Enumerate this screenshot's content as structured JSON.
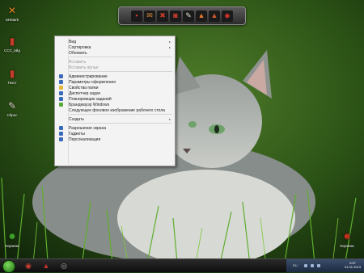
{
  "desktop": {
    "icons": [
      {
        "name": "desktop-icon-orange-x",
        "label": "SHMark",
        "glyph": "✕",
        "color": "#e8862a"
      },
      {
        "name": "desktop-icon-doc-1",
        "label": "ССС_вйд",
        "glyph": "▮",
        "color": "#c83a2a"
      },
      {
        "name": "desktop-icon-doc-2",
        "label": "Текст",
        "glyph": "▮",
        "color": "#c83a2a"
      },
      {
        "name": "desktop-icon-doc-3",
        "label": "Сброс",
        "glyph": "✎",
        "color": "#d8d0c0"
      },
      {
        "name": "desktop-icon-green-bug",
        "label": "Корзина",
        "glyph": "✹",
        "color": "#3ca328"
      },
      {
        "name": "desktop-icon-red-bug",
        "label": "Корзина",
        "glyph": "✹",
        "color": "#c0301c"
      }
    ]
  },
  "dock": {
    "icons": [
      {
        "name": "dock-icon-1",
        "glyph": "▪",
        "color": "#c43a2a"
      },
      {
        "name": "dock-icon-2",
        "glyph": "✉",
        "color": "#e08a3a"
      },
      {
        "name": "dock-icon-3",
        "glyph": "✖",
        "color": "#c43a2a"
      },
      {
        "name": "dock-icon-4",
        "glyph": "◙",
        "color": "#d04030"
      },
      {
        "name": "dock-icon-5",
        "glyph": "✎",
        "color": "#e6e0d0"
      },
      {
        "name": "dock-icon-6",
        "glyph": "▲",
        "color": "#e07830"
      },
      {
        "name": "dock-icon-7",
        "glyph": "▲",
        "color": "#d05a2a"
      },
      {
        "name": "dock-icon-8",
        "glyph": "◆",
        "color": "#c4302a"
      }
    ]
  },
  "context_menu": {
    "items": [
      {
        "label": "Вид",
        "enabled": true,
        "submenu": true,
        "icon": null
      },
      {
        "label": "Сортировка",
        "enabled": true,
        "submenu": true,
        "icon": null
      },
      {
        "label": "Обновить",
        "enabled": true,
        "submenu": false,
        "icon": null
      },
      {
        "label": "Вставить",
        "enabled": false,
        "submenu": false,
        "icon": null
      },
      {
        "label": "Вставить ярлык",
        "enabled": false,
        "submenu": false,
        "icon": null
      },
      {
        "label": "Администрирование",
        "enabled": true,
        "submenu": false,
        "icon": "#3a6ab8"
      },
      {
        "label": "Параметры оформления",
        "enabled": true,
        "submenu": false,
        "icon": "#3a6ab8"
      },
      {
        "label": "Свойства папки",
        "enabled": true,
        "submenu": false,
        "icon": "#e2b83a"
      },
      {
        "label": "Диспетчер задач",
        "enabled": true,
        "submenu": false,
        "icon": "#3a6ab8"
      },
      {
        "label": "Планировщик заданий",
        "enabled": true,
        "submenu": false,
        "icon": "#3a6ab8"
      },
      {
        "label": "Брандмауэр Windows",
        "enabled": true,
        "submenu": false,
        "icon": "#5aa83a"
      },
      {
        "label": "Следующее фоновое изображение рабочего стола",
        "enabled": true,
        "submenu": false,
        "icon": null
      },
      {
        "label": "Создать",
        "enabled": true,
        "submenu": true,
        "icon": null
      },
      {
        "label": "Разрешение экрана",
        "enabled": true,
        "submenu": false,
        "icon": "#3a6ab8"
      },
      {
        "label": "Гаджеты",
        "enabled": true,
        "submenu": false,
        "icon": "#3a6ab8"
      },
      {
        "label": "Персонализация",
        "enabled": true,
        "submenu": false,
        "icon": "#3a6ab8"
      }
    ],
    "submenu_arrow": "▸"
  },
  "taskbar": {
    "language": "RU",
    "clock_time": "0:57",
    "clock_date": "01.01.2013",
    "icons": [
      {
        "name": "taskbar-icon-1",
        "glyph": "◉",
        "color": "#d04030"
      },
      {
        "name": "taskbar-icon-2",
        "glyph": "▲",
        "color": "#c0302a"
      },
      {
        "name": "taskbar-icon-3",
        "glyph": "◎",
        "color": "#aaaaaa"
      }
    ]
  },
  "colors": {
    "accent": "#3a6ab8"
  }
}
